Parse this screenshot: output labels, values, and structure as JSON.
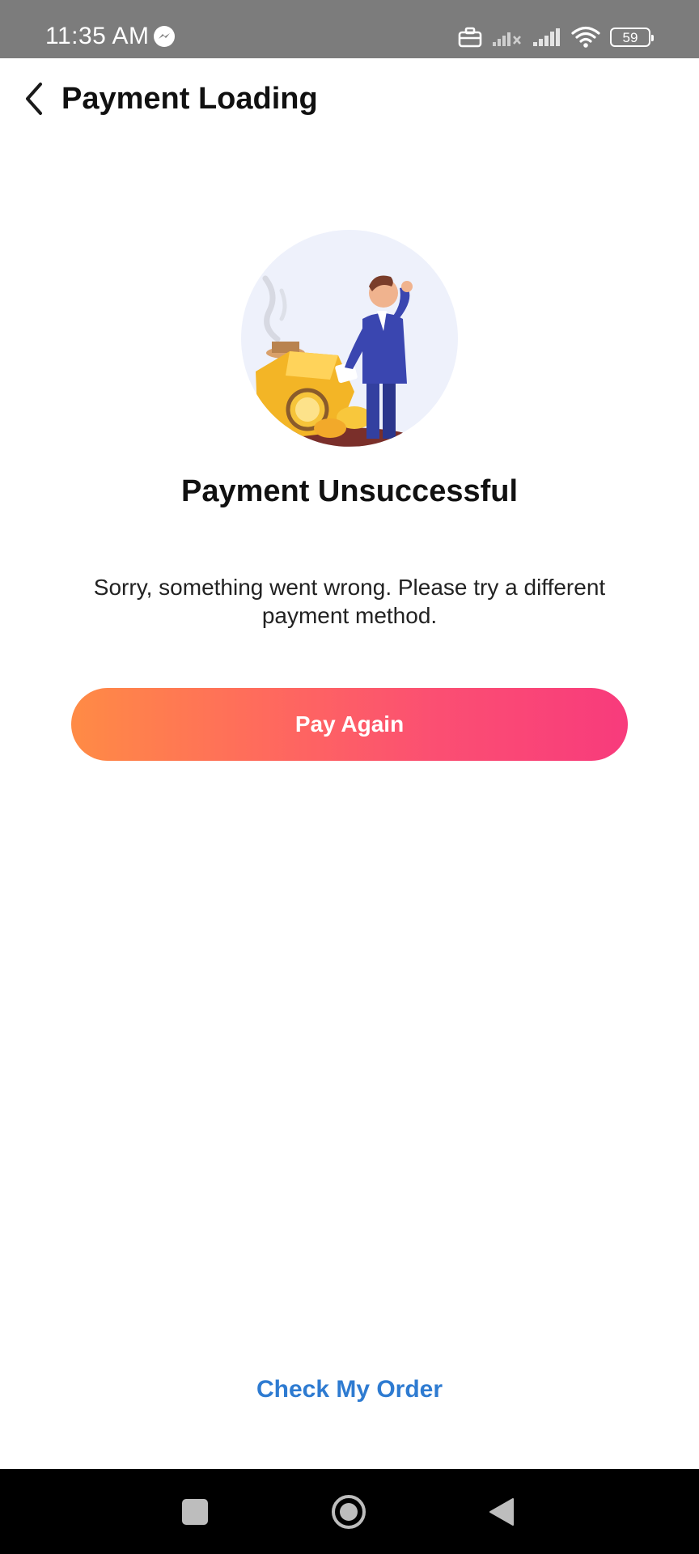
{
  "status_bar": {
    "time": "11:35 AM",
    "battery_level": "59",
    "icons": [
      "messenger-icon",
      "work-profile-icon",
      "signal-off-icon",
      "signal-icon",
      "wifi-icon",
      "battery-icon"
    ]
  },
  "header": {
    "title": "Payment Loading",
    "back_icon": "chevron-left-icon"
  },
  "result": {
    "illustration": "payment-failed-illustration",
    "title": "Payment Unsuccessful",
    "message": "Sorry, something went wrong. Please try a different payment method."
  },
  "actions": {
    "pay_again_label": "Pay Again",
    "check_order_label": "Check My Order"
  },
  "colors": {
    "button_gradient_start": "#ff8b45",
    "button_gradient_end": "#f83b7c",
    "link": "#2e7bd1",
    "status_bar": "#7c7c7c"
  },
  "nav_bar": {
    "icons": [
      "recents-square-icon",
      "home-circle-icon",
      "back-triangle-icon"
    ]
  }
}
